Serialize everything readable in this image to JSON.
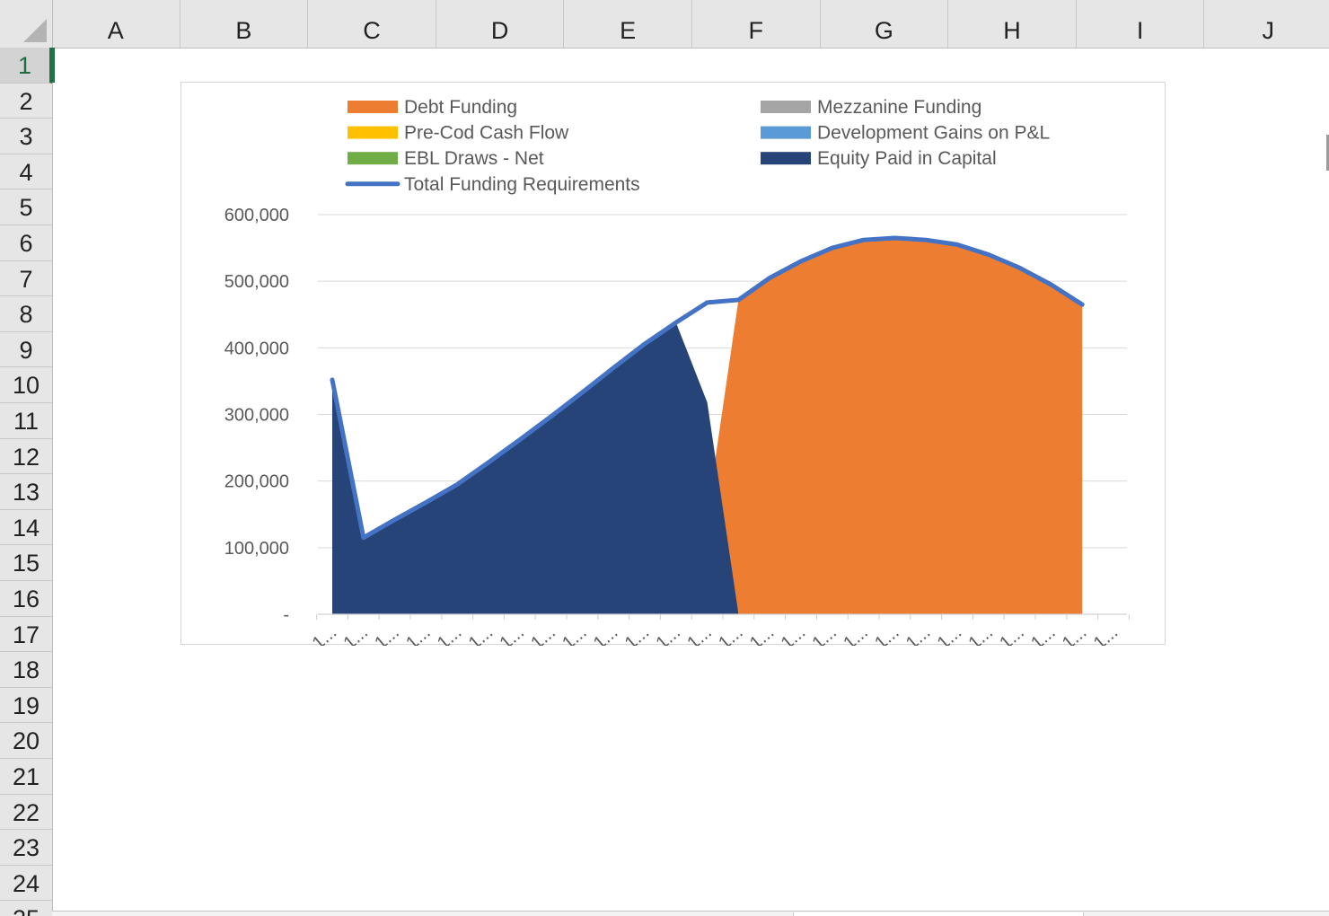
{
  "spreadsheet": {
    "columns": [
      "A",
      "B",
      "C",
      "D",
      "E",
      "F",
      "G",
      "H",
      "I",
      "J"
    ],
    "rows": [
      "1",
      "2",
      "3",
      "4",
      "5",
      "6",
      "7",
      "8",
      "9",
      "10",
      "11",
      "12",
      "13",
      "14",
      "15",
      "16",
      "17",
      "18",
      "19",
      "20",
      "21",
      "22",
      "23",
      "24",
      "25"
    ],
    "active_row": "1"
  },
  "chart_data": {
    "type": "area",
    "title": "",
    "xlabel": "",
    "ylabel": "",
    "ylim": [
      0,
      600000
    ],
    "yticks": [
      "-",
      "100,000",
      "200,000",
      "300,000",
      "400,000",
      "500,000",
      "600,000"
    ],
    "categories": [
      "1...",
      "1...",
      "1...",
      "1...",
      "1...",
      "1...",
      "1...",
      "1...",
      "1...",
      "1...",
      "1...",
      "1...",
      "1...",
      "1...",
      "1...",
      "1...",
      "1...",
      "1...",
      "1...",
      "1...",
      "1...",
      "1...",
      "1...",
      "1...",
      "1...",
      "1..."
    ],
    "gridlines": true,
    "legend_position": "top",
    "series": [
      {
        "name": "Debt Funding",
        "kind": "area",
        "color": "#ED7D31",
        "values": [
          0,
          0,
          0,
          0,
          0,
          0,
          0,
          0,
          0,
          0,
          0,
          0,
          150000,
          472000,
          505000,
          530000,
          550000,
          562000,
          565000,
          562000,
          555000,
          540000,
          520000,
          495000,
          465000
        ]
      },
      {
        "name": "Mezzanine Funding",
        "kind": "area",
        "color": "#A5A5A5",
        "values": [
          0,
          0,
          0,
          0,
          0,
          0,
          0,
          0,
          0,
          0,
          0,
          0,
          0,
          0,
          0,
          0,
          0,
          0,
          0,
          0,
          0,
          0,
          0,
          0,
          0
        ]
      },
      {
        "name": "Pre-Cod Cash Flow",
        "kind": "area",
        "color": "#FFC000",
        "values": [
          0,
          0,
          0,
          0,
          0,
          0,
          0,
          0,
          0,
          0,
          0,
          0,
          0,
          0,
          0,
          0,
          0,
          0,
          0,
          0,
          0,
          0,
          0,
          0,
          0
        ]
      },
      {
        "name": "Development Gains on P&L",
        "kind": "area",
        "color": "#5B9BD5",
        "values": [
          0,
          0,
          0,
          0,
          0,
          0,
          0,
          0,
          0,
          0,
          0,
          0,
          0,
          0,
          0,
          0,
          0,
          0,
          0,
          0,
          0,
          0,
          0,
          0,
          0
        ]
      },
      {
        "name": "EBL Draws - Net",
        "kind": "area",
        "color": "#70AD47",
        "values": [
          0,
          0,
          0,
          0,
          0,
          0,
          0,
          0,
          0,
          0,
          0,
          0,
          0,
          0,
          0,
          0,
          0,
          0,
          0,
          0,
          0,
          0,
          0,
          0,
          0
        ]
      },
      {
        "name": "Equity Paid in Capital",
        "kind": "area",
        "color": "#264478",
        "values": [
          352000,
          115000,
          142000,
          168000,
          195000,
          228000,
          262000,
          297000,
          333000,
          370000,
          406000,
          438000,
          318000,
          0,
          0,
          0,
          0,
          0,
          0,
          0,
          0,
          0,
          0,
          0,
          0
        ]
      },
      {
        "name": "Total Funding Requirements",
        "kind": "line",
        "color": "#4472C4",
        "values": [
          352000,
          115000,
          142000,
          168000,
          195000,
          228000,
          262000,
          297000,
          333000,
          370000,
          406000,
          438000,
          468000,
          472000,
          505000,
          530000,
          550000,
          562000,
          565000,
          562000,
          555000,
          540000,
          520000,
          495000,
          465000
        ]
      }
    ]
  }
}
